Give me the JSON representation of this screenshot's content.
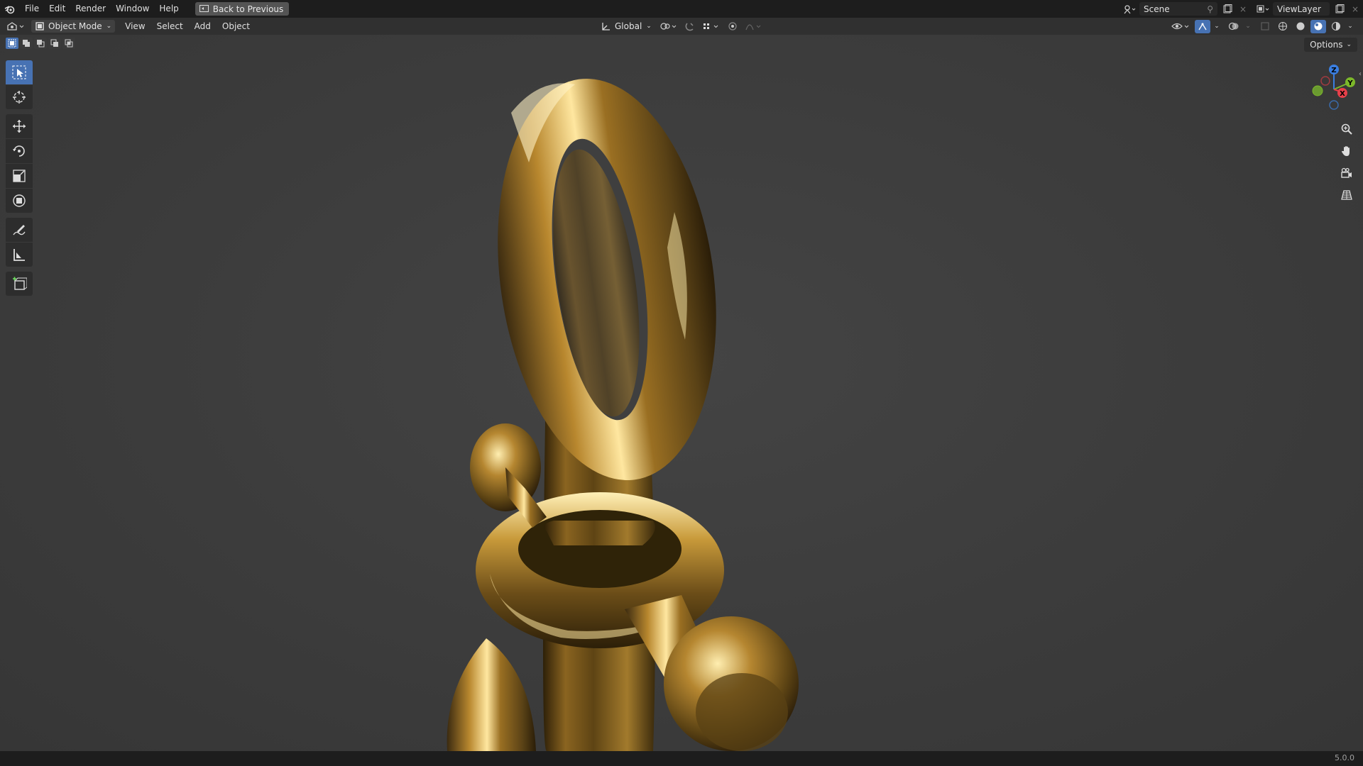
{
  "topbar": {
    "menu": [
      "File",
      "Edit",
      "Render",
      "Window",
      "Help"
    ],
    "back_button": "Back to Previous",
    "scene": "Scene",
    "view_layer": "ViewLayer"
  },
  "header": {
    "mode": "Object Mode",
    "menu": [
      "View",
      "Select",
      "Add",
      "Object"
    ],
    "transform_orientation": "Global"
  },
  "viewport": {
    "options": "Options",
    "gizmo_axes": {
      "z": "Z",
      "y": "Y",
      "x": "X"
    }
  },
  "statusbar": {
    "version": "5.0.0"
  },
  "colors": {
    "accent": "#4772b3",
    "axis_x": "#e8404a",
    "axis_y": "#7cb82a",
    "axis_z": "#3a7ee0"
  }
}
